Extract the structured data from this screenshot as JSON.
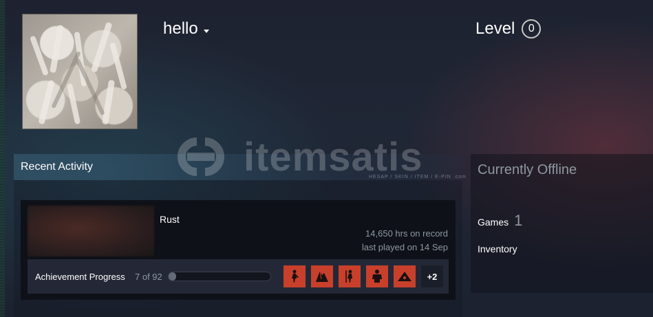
{
  "profile": {
    "username": "hello",
    "level_label": "Level",
    "level_value": "0"
  },
  "recent_activity": {
    "header": "Recent Activity",
    "game": {
      "name": "Rust",
      "hours": "14,650 hrs on record",
      "last_played": "last played on 14 Sep"
    },
    "achievements": {
      "label": "Achievement Progress",
      "count": "7 of 92",
      "progress_fraction": 0.076,
      "more": "+2",
      "icons": [
        "figure-icon",
        "shard-icon",
        "hunter-icon",
        "brute-icon",
        "tent-icon"
      ]
    }
  },
  "sidebar": {
    "status": "Currently Offline",
    "games_label": "Games",
    "games_count": "1",
    "inventory_label": "Inventory"
  },
  "watermark": {
    "text": "itemsatis",
    "subtext": "HESAP / SKIN / ITEM / E-PIN .com"
  },
  "colors": {
    "achievement_icon_bg": "#c8402c",
    "muted_text": "#8f98a0"
  }
}
